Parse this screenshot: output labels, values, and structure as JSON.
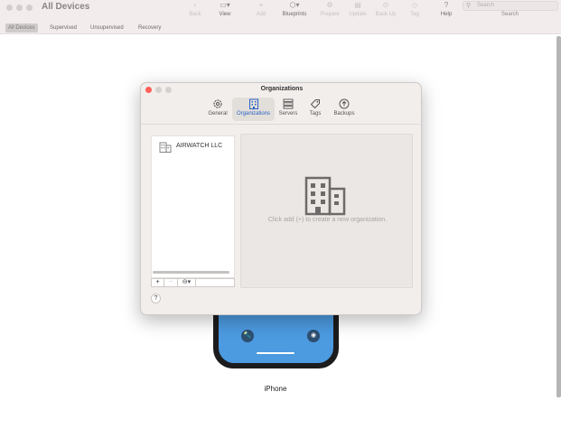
{
  "window": {
    "title": "All Devices"
  },
  "toolbar": {
    "items": [
      {
        "label": "Back",
        "icon": "back-icon",
        "glyph": "‹"
      },
      {
        "label": "View",
        "icon": "view-icon",
        "glyph": "▭▾"
      },
      {
        "label": "Add",
        "icon": "add-icon",
        "glyph": "+"
      },
      {
        "label": "Blueprints",
        "icon": "blueprints-icon",
        "glyph": "⬡▾"
      },
      {
        "label": "Prepare",
        "icon": "prepare-icon",
        "glyph": "⚙"
      },
      {
        "label": "Update",
        "icon": "update-icon",
        "glyph": "▤"
      },
      {
        "label": "Back Up",
        "icon": "backup-icon",
        "glyph": "⊙"
      },
      {
        "label": "Tag",
        "icon": "tag-icon",
        "glyph": "◇"
      },
      {
        "label": "Help",
        "icon": "help-icon",
        "glyph": "?"
      }
    ],
    "search_placeholder": "Search",
    "search_label": "Search"
  },
  "filters": [
    {
      "label": "All Devices",
      "selected": true
    },
    {
      "label": "Supervised",
      "selected": false
    },
    {
      "label": "Unsupervised",
      "selected": false
    },
    {
      "label": "Recovery",
      "selected": false
    }
  ],
  "device": {
    "name": "iPhone",
    "screen_color": "#4c9ae0"
  },
  "dialog": {
    "title": "Organizations",
    "tabs": [
      {
        "label": "General",
        "icon": "gear-icon",
        "selected": false
      },
      {
        "label": "Organizations",
        "icon": "building-icon",
        "selected": true
      },
      {
        "label": "Servers",
        "icon": "servers-icon",
        "selected": false
      },
      {
        "label": "Tags",
        "icon": "tag-icon",
        "selected": false
      },
      {
        "label": "Backups",
        "icon": "backup-icon",
        "selected": false
      }
    ],
    "organizations": [
      {
        "name": "AIRWATCH LLC",
        "icon": "building-icon"
      }
    ],
    "list_buttons": {
      "add": "+",
      "remove": "−",
      "more": "⊖▾"
    },
    "empty_message": "Click add (+) to create a new organization.",
    "help": "?"
  },
  "colors": {
    "accent": "#2a63c7",
    "close": "#fe5f57",
    "inactive_light": "#d3cdcd"
  }
}
